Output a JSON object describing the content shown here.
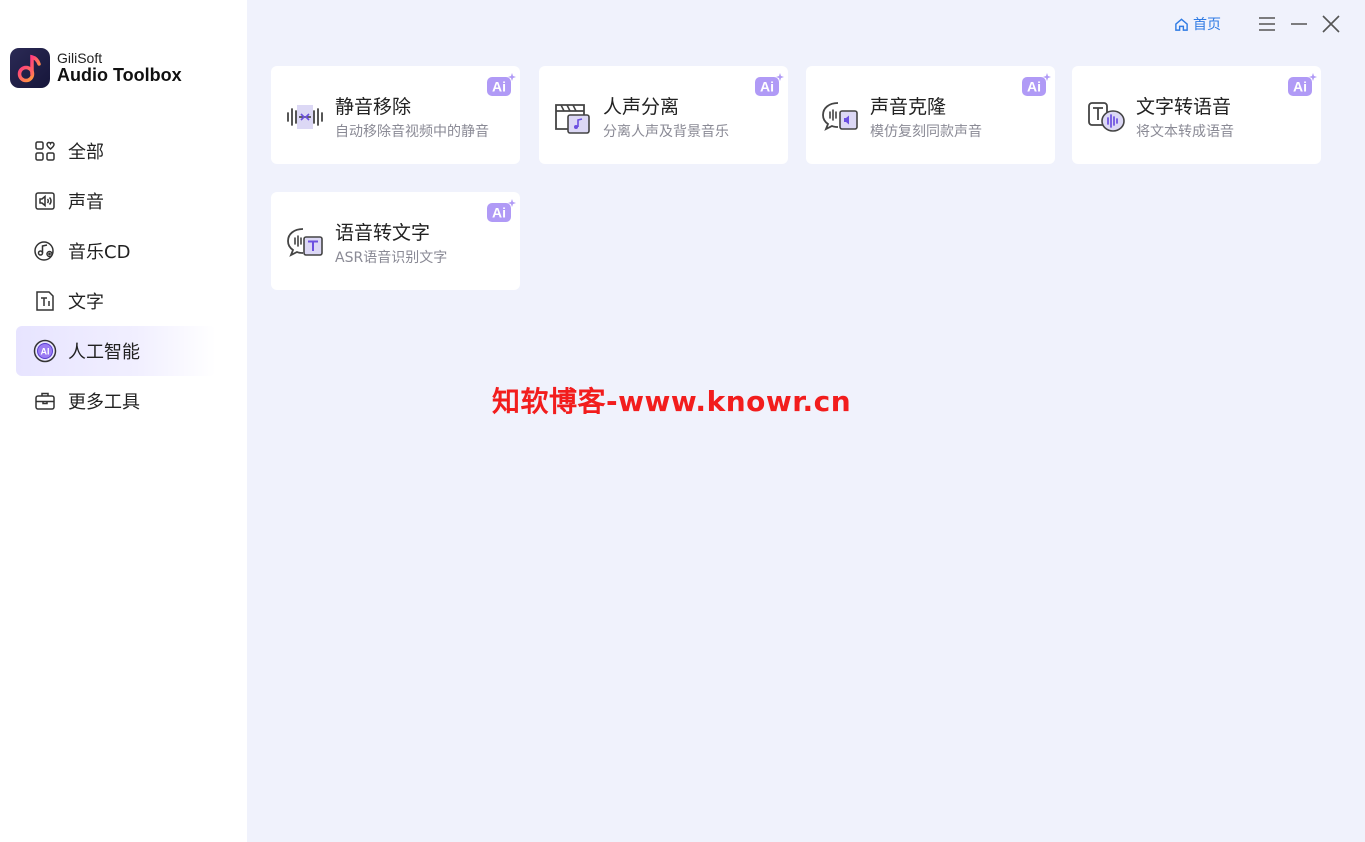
{
  "brand": {
    "small": "GiliSoft",
    "big": "Audio Toolbox"
  },
  "sidebar": {
    "items": [
      {
        "label": "全部",
        "icon": "grid-icon"
      },
      {
        "label": "声音",
        "icon": "speaker-file-icon"
      },
      {
        "label": "音乐CD",
        "icon": "music-cd-icon"
      },
      {
        "label": "文字",
        "icon": "text-file-icon"
      },
      {
        "label": "人工智能",
        "icon": "ai-circle-icon",
        "active": true
      },
      {
        "label": "更多工具",
        "icon": "toolbox-icon"
      }
    ]
  },
  "topbar": {
    "home_label": "首页"
  },
  "cards": [
    {
      "title": "静音移除",
      "desc": "自动移除音视频中的静音",
      "badge": "Ai"
    },
    {
      "title": "人声分离",
      "desc": "分离人声及背景音乐",
      "badge": "Ai"
    },
    {
      "title": "声音克隆",
      "desc": "模仿复刻同款声音",
      "badge": "Ai"
    },
    {
      "title": "文字转语音",
      "desc": "将文本转成语音",
      "badge": "Ai"
    },
    {
      "title": "语音转文字",
      "desc": "ASR语音识别文字",
      "badge": "Ai"
    }
  ],
  "watermark": "知软博客-www.knowr.cn",
  "colors": {
    "accent": "#2f7be4",
    "ai_purple": "#9b7cf3",
    "active_bg": "#e7e4ff",
    "watermark": "#f21d1d"
  }
}
